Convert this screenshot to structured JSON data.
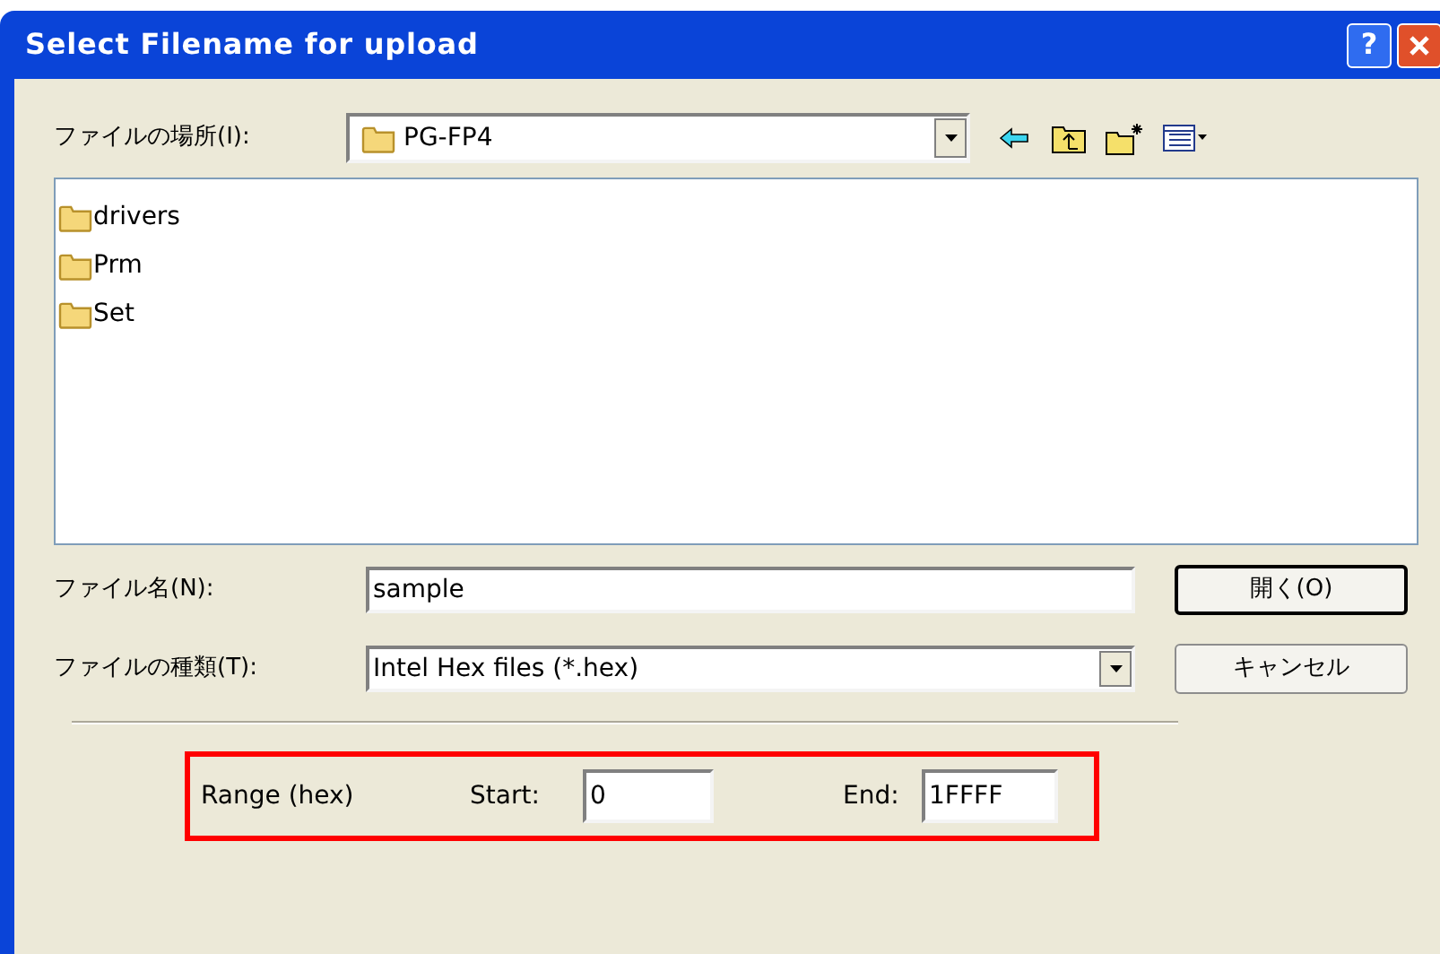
{
  "window": {
    "title": "Select Filename for upload",
    "buttons": [
      "?"
    ]
  },
  "location": {
    "label": "ファイルの場所(I):",
    "value": "PG-FP4"
  },
  "files": [
    {
      "name": "drivers"
    },
    {
      "name": "Prm"
    },
    {
      "name": "Set"
    }
  ],
  "filename": {
    "label": "ファイル名(N):",
    "value": "sample"
  },
  "filetype": {
    "label": "ファイルの種類(T):",
    "value": "Intel Hex files (*.hex)"
  },
  "actions": [
    "開く(O)",
    "キャンセル"
  ],
  "range": {
    "label": "Range (hex)",
    "start_label": "Start:",
    "start": "0",
    "end_label": "End:",
    "end": "1FFFF"
  }
}
